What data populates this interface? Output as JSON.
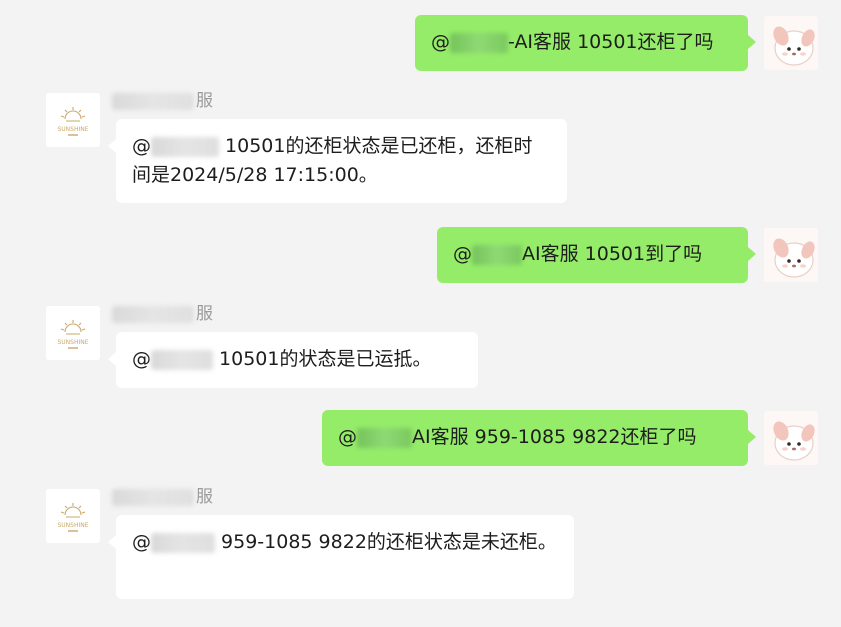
{
  "messages": [
    {
      "side": "sent",
      "text_before": "@",
      "text_after": "-AI客服 10501还柜了吗",
      "avatar_icon": "cartoon-dog-avatar-icon"
    },
    {
      "side": "received",
      "sender_visible": "服",
      "text_before": "@",
      "text_after": " 10501的还柜状态是已还柜，还柜时间是2024/5/28 17:15:00。",
      "avatar_icon": "sunshine-logo-avatar-icon",
      "avatar_logo_text": "SUNSHINE"
    },
    {
      "side": "sent",
      "text_before": "@",
      "text_after": "AI客服 10501到了吗",
      "avatar_icon": "cartoon-dog-avatar-icon"
    },
    {
      "side": "received",
      "sender_visible": "服",
      "text_before": "@",
      "text_after": " 10501的状态是已运抵。",
      "avatar_icon": "sunshine-logo-avatar-icon",
      "avatar_logo_text": "SUNSHINE"
    },
    {
      "side": "sent",
      "text_before": "@",
      "text_after": "AI客服 959-1085 9822还柜了吗",
      "avatar_icon": "cartoon-dog-avatar-icon"
    },
    {
      "side": "received",
      "sender_visible": "服",
      "text_before": "@",
      "text_after": " 959-1085 9822的还柜状态是未还柜。",
      "avatar_icon": "sunshine-logo-avatar-icon",
      "avatar_logo_text": "SUNSHINE"
    }
  ],
  "colors": {
    "background": "#f3f3f3",
    "sent_bubble": "#95ec69",
    "received_bubble": "#ffffff",
    "sender_name": "#9b9b9b",
    "logo_gold": "#c9a96a"
  }
}
